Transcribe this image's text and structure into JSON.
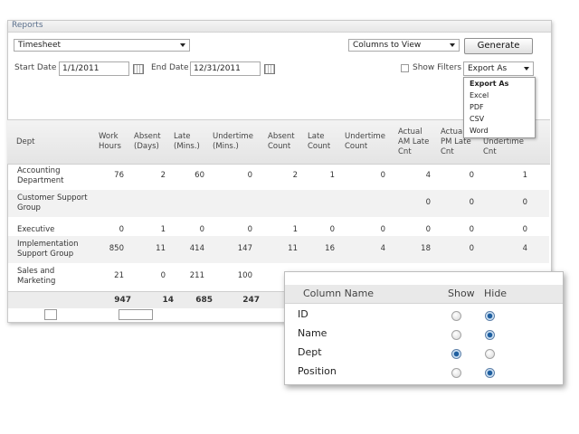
{
  "panel": {
    "title": "Reports"
  },
  "controls": {
    "report_type": "Timesheet",
    "columns_to_view": "Columns to View",
    "generate_label": "Generate",
    "start_date_label": "Start Date",
    "start_date_value": "1/1/2011",
    "end_date_label": "End Date",
    "end_date_value": "12/31/2011",
    "show_filters_label": "Show Filters",
    "export_as": "Export As"
  },
  "export_menu": {
    "items": [
      "Export As",
      "Excel",
      "PDF",
      "CSV",
      "Word"
    ]
  },
  "table": {
    "headers": [
      [
        "Dept"
      ],
      [
        "Work",
        "Hours"
      ],
      [
        "Absent",
        "(Days)"
      ],
      [
        "Late",
        "(Mins.)"
      ],
      [
        "Undertime",
        "(Mins.)"
      ],
      [
        "Absent",
        "Count"
      ],
      [
        "Late",
        "Count"
      ],
      [
        "Undertime",
        "Count"
      ],
      [
        "Actual",
        "AM Late",
        "Cnt"
      ],
      [
        "Actual",
        "PM Late",
        "Cnt"
      ],
      [
        "Undertime",
        "Cnt"
      ]
    ],
    "rows": [
      {
        "dept": [
          "Accounting",
          "Department"
        ],
        "values": [
          "76",
          "2",
          "60",
          "0",
          "2",
          "1",
          "0",
          "4",
          "0",
          "1"
        ]
      },
      {
        "dept": [
          "Customer Support",
          "Group"
        ],
        "values": [
          "",
          "",
          "",
          "",
          "",
          "",
          "",
          "0",
          "0",
          "0"
        ]
      },
      {
        "dept": [
          "Executive"
        ],
        "values": [
          "0",
          "1",
          "0",
          "0",
          "1",
          "0",
          "0",
          "0",
          "0",
          "0"
        ]
      },
      {
        "dept": [
          "Implementation",
          "Support Group"
        ],
        "values": [
          "850",
          "11",
          "414",
          "147",
          "11",
          "16",
          "4",
          "18",
          "0",
          "4"
        ]
      },
      {
        "dept": [
          "Sales and",
          "Marketing"
        ],
        "values": [
          "21",
          "0",
          "211",
          "100",
          "",
          "",
          "",
          "",
          "",
          ""
        ]
      }
    ],
    "totals": [
      "947",
      "14",
      "685",
      "247"
    ]
  },
  "column_picker": {
    "headers": {
      "name": "Column Name",
      "show": "Show",
      "hide": "Hide"
    },
    "columns": [
      {
        "name": "ID",
        "show": false
      },
      {
        "name": "Name",
        "show": false
      },
      {
        "name": "Dept",
        "show": true
      },
      {
        "name": "Position",
        "show": false
      }
    ]
  }
}
